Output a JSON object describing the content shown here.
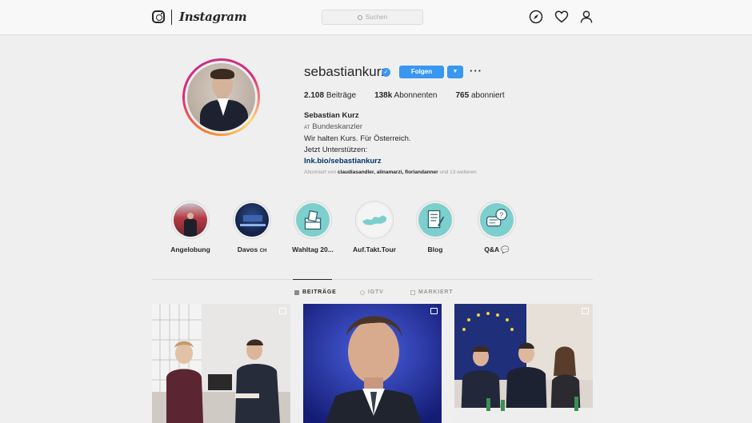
{
  "nav": {
    "wordmark": "Instagram",
    "search_placeholder": "Suchen"
  },
  "profile": {
    "username": "sebastiankurz",
    "verified": true,
    "follow_label": "Folgen",
    "stats": {
      "posts_count": "2.108",
      "posts_label": "Beiträge",
      "followers_count": "138k",
      "followers_label": "Abonnenten",
      "following_count": "765",
      "following_label": "abonniert"
    },
    "bio": {
      "full_name": "Sebastian Kurz",
      "country_code": "AT",
      "category": "Bundeskanzler",
      "line1": "Wir halten Kurs. Für Österreich.",
      "line2": "Jetzt Unterstützen:",
      "link": "lnk.bio/sebastiankurz"
    },
    "followed_by": {
      "prefix": "Abonniert von",
      "users": "claudiasandler, alinamarzi, floriandanner",
      "suffix": "und 13 weiteren"
    }
  },
  "highlights": [
    {
      "label": "Angelobung",
      "icon": "ceremony-photo"
    },
    {
      "label": "Davos",
      "flag": "CH",
      "icon": "conference-photo"
    },
    {
      "label": "Wahltag 20...",
      "icon": "ballot-box-icon"
    },
    {
      "label": "Auf.Takt.Tour",
      "icon": "austria-map-icon"
    },
    {
      "label": "Blog",
      "icon": "document-pen-icon"
    },
    {
      "label": "Q&A",
      "icon": "chat-bubbles-icon"
    }
  ],
  "tabs": [
    {
      "label": "BEITRÄGE",
      "active": true,
      "icon": "grid-icon"
    },
    {
      "label": "IGTV",
      "active": false,
      "icon": "igtv-icon"
    },
    {
      "label": "MARKIERT",
      "active": false,
      "icon": "tag-icon"
    }
  ],
  "colors": {
    "accent": "#3897f0",
    "highlight_teal": "#7ccfcc",
    "background": "#efefef"
  }
}
